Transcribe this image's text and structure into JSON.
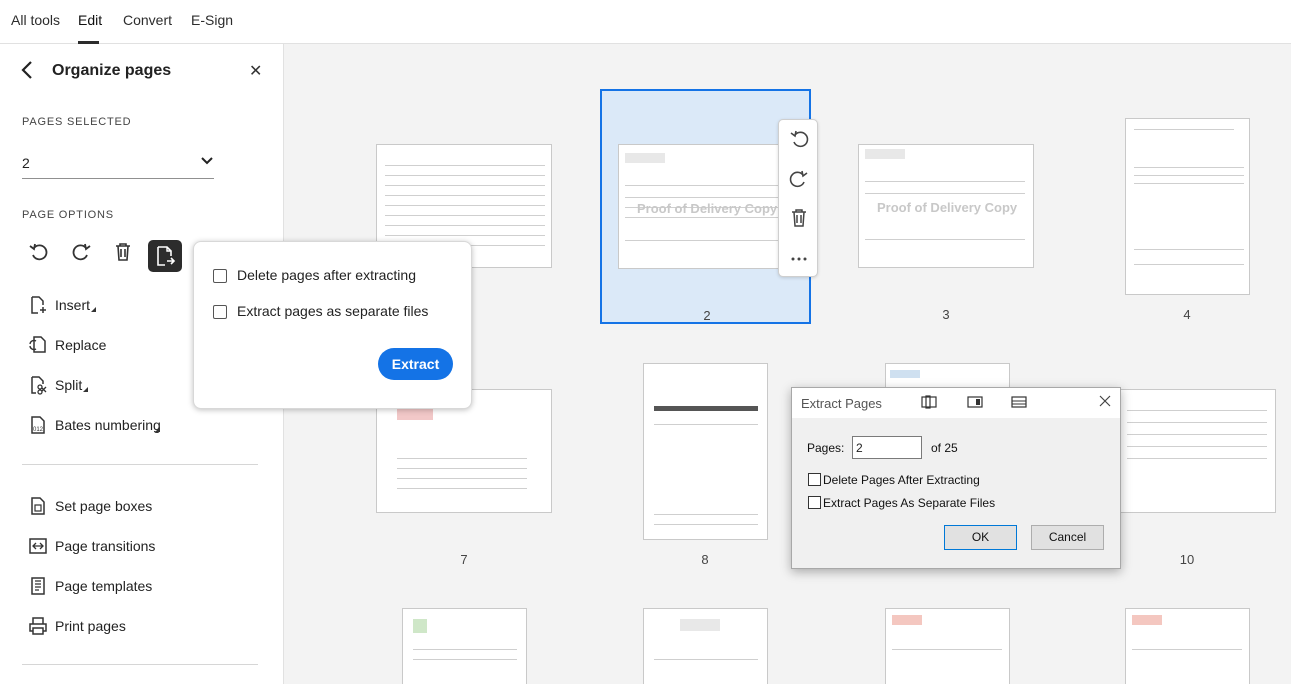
{
  "topbar": {
    "tabs": [
      "All tools",
      "Edit",
      "Convert",
      "E-Sign"
    ],
    "active_tab": "Edit"
  },
  "panel": {
    "title": "Organize pages",
    "pages_selected_label": "PAGES SELECTED",
    "pages_selected_value": "2",
    "page_options_label": "PAGE OPTIONS",
    "tools": [
      {
        "label": "Insert",
        "icon": "insert-page-icon",
        "has_submenu": true
      },
      {
        "label": "Replace",
        "icon": "replace-page-icon",
        "has_submenu": false
      },
      {
        "label": "Split",
        "icon": "split-icon",
        "has_submenu": true
      },
      {
        "label": "Bates numbering",
        "icon": "bates-numbering-icon",
        "has_submenu": true
      }
    ],
    "more_tools": [
      {
        "label": "Set page boxes",
        "icon": "page-boxes-icon"
      },
      {
        "label": "Page transitions",
        "icon": "page-transitions-icon"
      },
      {
        "label": "Page templates",
        "icon": "page-templates-icon"
      },
      {
        "label": "Print pages",
        "icon": "printer-icon"
      }
    ]
  },
  "popover": {
    "option_delete": "Delete pages after extracting",
    "option_separate": "Extract pages as separate files",
    "extract_label": "Extract"
  },
  "pages": {
    "row1": [
      "2",
      "3",
      "4"
    ],
    "row2": [
      "7",
      "8",
      "10"
    ],
    "watermark": "Proof of Delivery Copy",
    "selected": "2"
  },
  "dialog": {
    "title": "Extract Pages",
    "pages_label": "Pages:",
    "pages_value": "2",
    "of_total": "of 25",
    "option_delete": "Delete Pages After Extracting",
    "option_separate": "Extract Pages As Separate Files",
    "ok_label": "OK",
    "cancel_label": "Cancel"
  },
  "colors": {
    "accent": "#1473e6",
    "selection_bg": "#dbe9f8"
  }
}
